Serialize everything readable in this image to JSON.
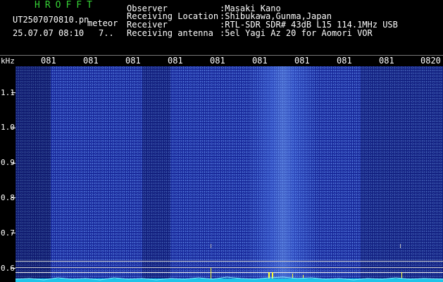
{
  "header": {
    "logo": "HROFFT",
    "filename": "UT2507070810.pn",
    "event_type": "meteor",
    "datetime": "25.07.07 08:10",
    "count": "7..",
    "fields": [
      {
        "label": "Observer",
        "value": ":Masaki Kano"
      },
      {
        "label": "Receiving Location",
        "value": ":Shibukawa,Gunma,Japan"
      },
      {
        "label": "Receiver",
        "value": ":RTL-SDR SDR# 43dB L15 114.1MHz USB"
      },
      {
        "label": "Receiving antenna",
        "value": ":5el Yagi Az 20 for Aomori VOR"
      }
    ]
  },
  "time_ticks": [
    "081",
    "081",
    "081",
    "081",
    "081",
    "081",
    "081",
    "081",
    "081",
    "0820"
  ],
  "freq_axis": {
    "unit": "kHz",
    "labels": [
      "1.1",
      "1.0",
      "0.9",
      "0.8",
      "0.7",
      "0.6"
    ]
  },
  "colors": {
    "background": "#000000",
    "spectrogram": "#061473",
    "logo": "#35d135",
    "marker": "#ffff33",
    "trace": "#22d8ff"
  }
}
